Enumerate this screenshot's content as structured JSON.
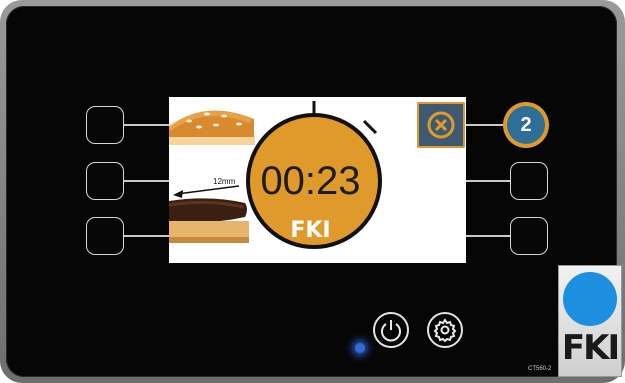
{
  "screen": {
    "timer": "00:23",
    "timer_brand": "FKI",
    "dimension_label": "12mm"
  },
  "queue_badge": "2",
  "device": {
    "logo_text": "FKI",
    "model": "CT560-2"
  },
  "icons": {
    "cancel": "cancel-x-icon",
    "power": "power-icon",
    "settings": "gear-icon"
  },
  "colors": {
    "timer_orange": "#e09a2c",
    "badge_blue": "#2f6e97",
    "cancel_slate": "#3d5a72",
    "logo_blue": "#1c8fde",
    "led_blue": "#2e6bd8"
  }
}
